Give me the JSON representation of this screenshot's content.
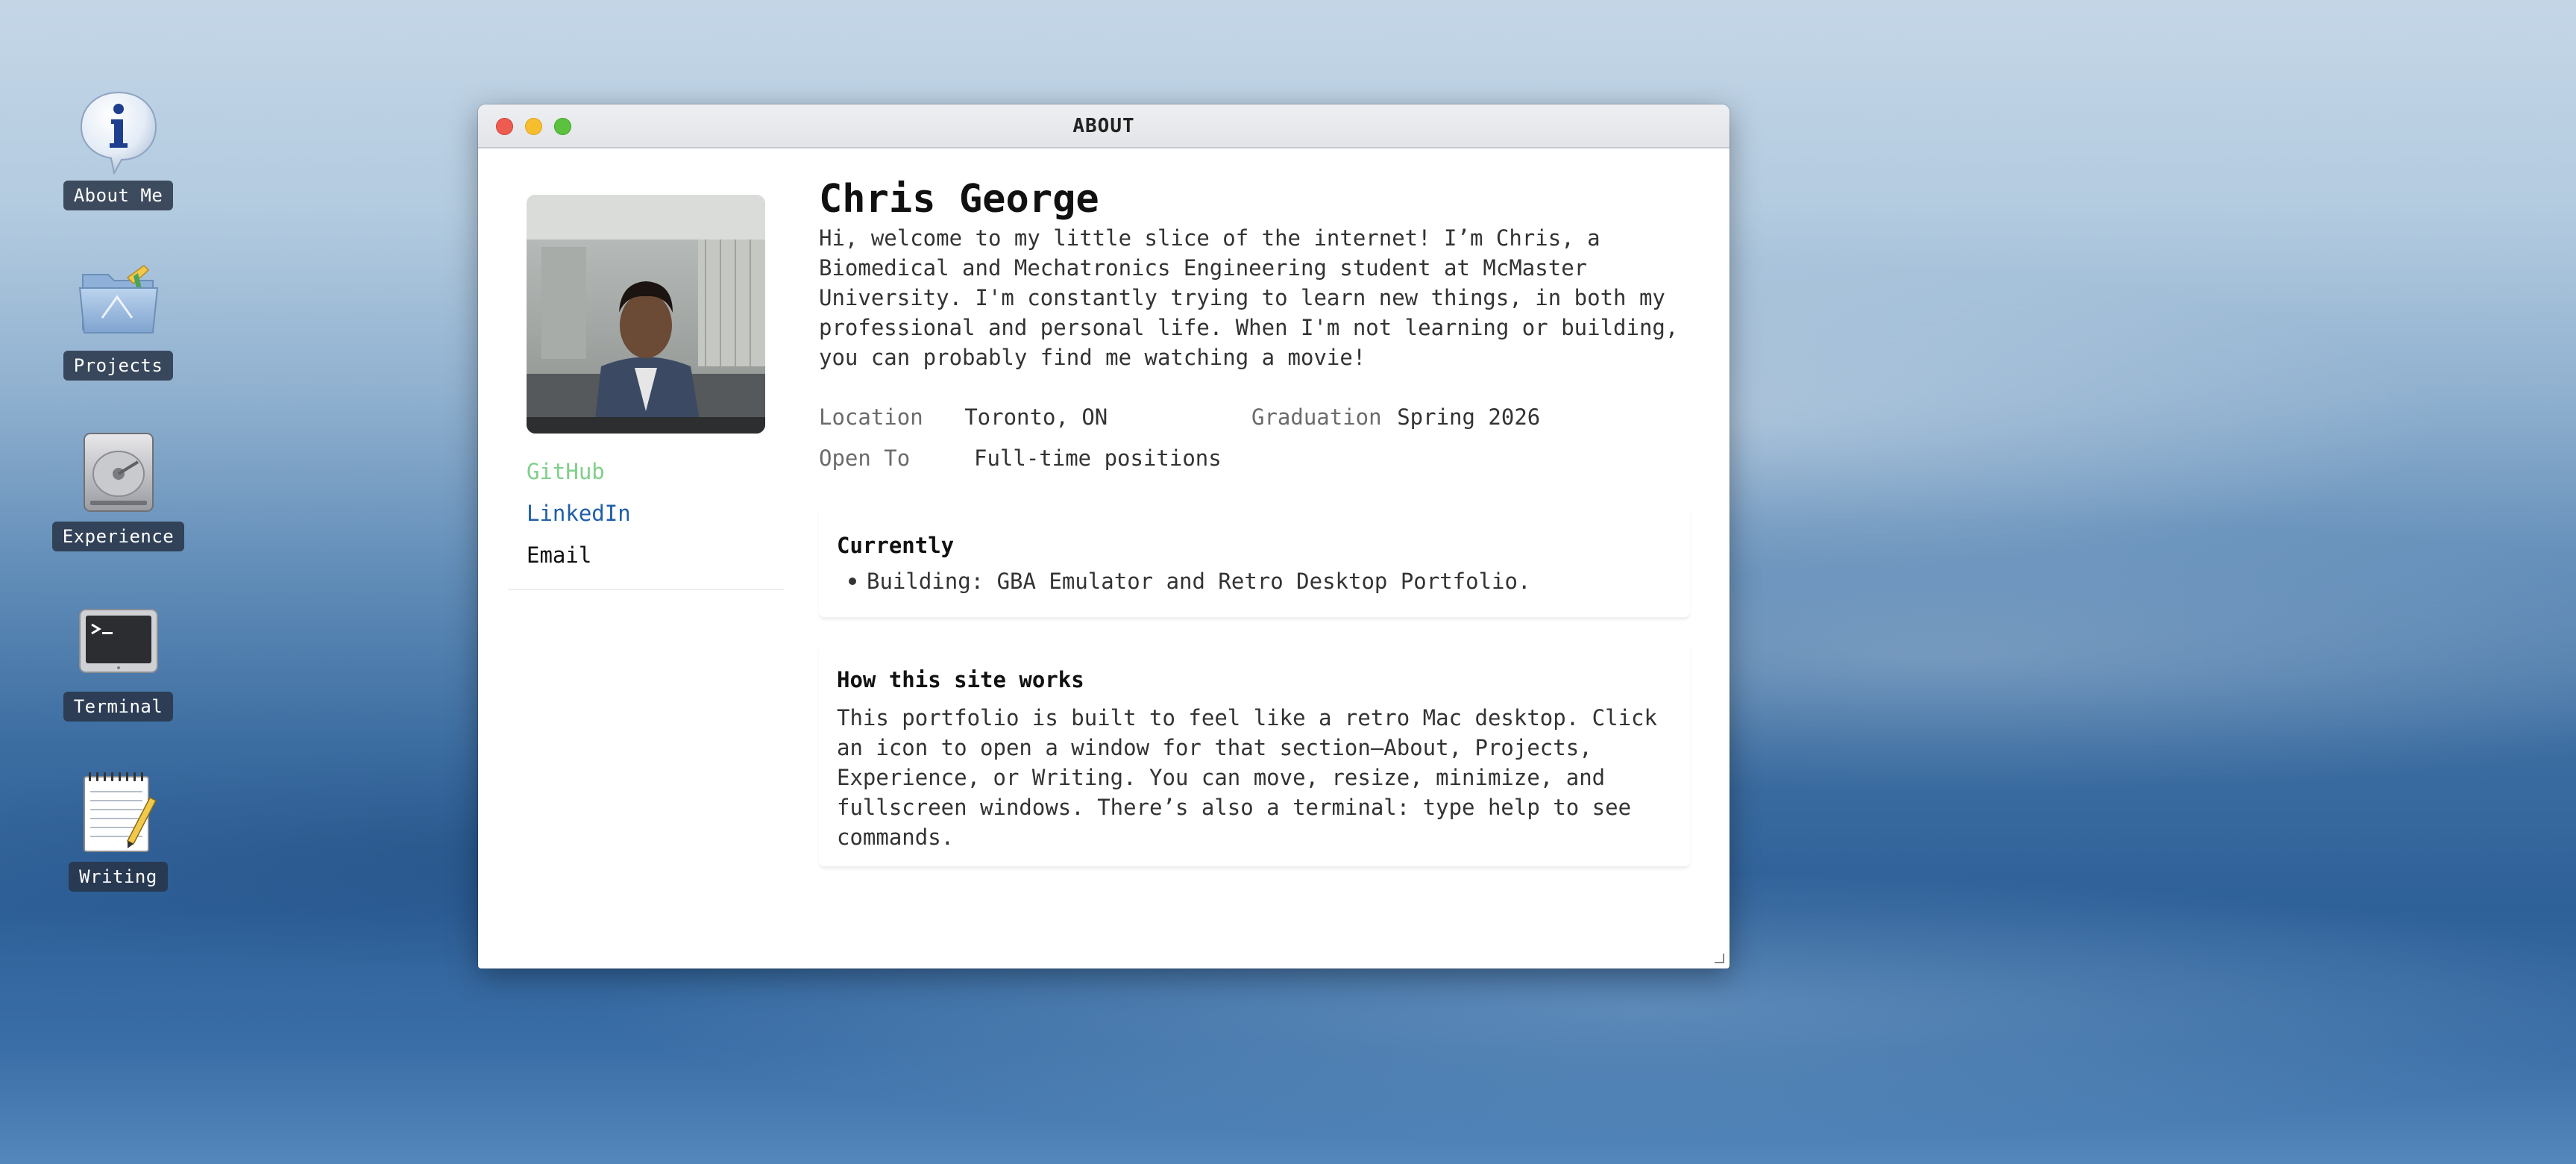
{
  "desktop": {
    "icons": [
      {
        "label": "About Me",
        "icon": "info-icon"
      },
      {
        "label": "Projects",
        "icon": "folder-icon"
      },
      {
        "label": "Experience",
        "icon": "hard-drive-icon"
      },
      {
        "label": "Terminal",
        "icon": "terminal-icon"
      },
      {
        "label": "Writing",
        "icon": "notepad-icon"
      }
    ]
  },
  "window": {
    "title": "ABOUT",
    "controls": [
      "close",
      "minimize",
      "fullscreen"
    ],
    "colors": {
      "close": "#ee5b51",
      "minimize": "#f6be2f",
      "fullscreen": "#5cc13f"
    }
  },
  "profile": {
    "avatar": "profile-photo",
    "links": [
      {
        "label": "GitHub",
        "color": "#7fcf8a"
      },
      {
        "label": "LinkedIn",
        "color": "#1f5fa8"
      },
      {
        "label": "Email",
        "color": "#111111"
      }
    ],
    "name": "Chris George",
    "bio": "Hi, welcome to my little slice of the internet! I’m Chris, a Biomedical and Mechatronics Engineering student at McMaster University. I'm constantly trying to learn new things, in both my professional and personal life. When I'm not learning or building, you can probably find me watching a movie!",
    "info": {
      "location_label": "Location",
      "location_value": "Toronto, ON",
      "graduation_label": "Graduation",
      "graduation_value": "Spring 2026",
      "open_to_label": "Open To",
      "open_to_value": "Full-time positions"
    }
  },
  "currently": {
    "title": "Currently",
    "items": [
      "Building: GBA Emulator and Retro Desktop Portfolio."
    ]
  },
  "how_it_works": {
    "title": "How this site works",
    "text": "This portfolio is built to feel like a retro Mac desktop. Click an icon to open a window for that section—About, Projects, Experience, or Writing. You can move, resize, minimize, and fullscreen windows. There’s also a terminal: type help to see commands."
  }
}
